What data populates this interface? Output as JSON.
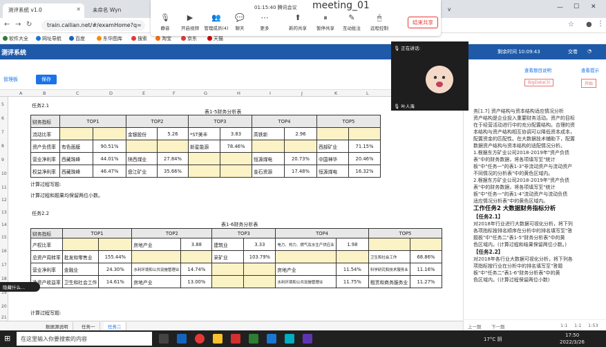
{
  "browser": {
    "tabs": [
      {
        "label": "测评系统 v1.0"
      },
      {
        "label": "未命名 Wyn"
      },
      {
        "label": "v"
      }
    ],
    "url": "train.cailian.net/#/examHome?q=",
    "bookmarks": [
      "软件大全",
      "网址导航",
      "百度",
      "东华图库",
      "搜索",
      "淘宝",
      "京东",
      "天猫"
    ]
  },
  "meeting": {
    "name": "meeting_01",
    "timer": "01:15:40",
    "app": "腾讯会议",
    "buttons": [
      "静音",
      "开启视频",
      "管理成员(4)",
      "聊天",
      "更多",
      "新的共享",
      "暂停共享",
      "互动批注",
      "远程控制"
    ],
    "end_share": "结束共享",
    "speaking": "正在讲话:",
    "participant": "叶人海"
  },
  "app": {
    "title": "测评系统",
    "header_time": "剩余时间 1:00:59:43",
    "header_submit": "交卷"
  },
  "toolbar": {
    "link": "管理板",
    "save": "保存"
  },
  "columns": [
    "A",
    "B",
    "C",
    "D",
    "E",
    "F",
    "G",
    "H",
    "I",
    "J",
    "K",
    "L"
  ],
  "rows": [
    "5",
    "6",
    "7",
    "8",
    "9",
    "10",
    "11",
    "12",
    "13",
    "14",
    "15",
    "16",
    "17",
    "18",
    "19",
    "20",
    "21",
    "22"
  ],
  "task21": {
    "title": "任务2.1",
    "caption": "表1-5财务分析表",
    "headers": [
      "财务指标",
      "TOP1",
      "TOP2",
      "TOP3",
      "TOP4",
      "TOP5"
    ],
    "rows": [
      [
        "流动比率",
        "",
        "",
        "金银股份",
        "5.26",
        "*ST美丰",
        "3.83",
        "高铁新",
        "2.96",
        "",
        ""
      ],
      [
        "资产负债率",
        "有色面膜",
        "90.51%",
        "",
        "",
        "新星能源",
        "78.46%",
        "",
        "",
        "西部矿业",
        "71.15%"
      ],
      [
        "营业净利率",
        "西藏珠峰",
        "44.01%",
        "陕西煤业",
        "27.84%",
        "",
        "",
        "恒源煤电",
        "20.73%",
        "中国神华",
        "20.46%"
      ],
      [
        "权益净利率",
        "西藏珠峰",
        "46.47%",
        "盘江矿业",
        "35.66%",
        "",
        "",
        "金石资源",
        "17.48%",
        "恒源煤电",
        "16.32%"
      ]
    ],
    "note1": "计算过程写题:",
    "note2": "计算过程和题果均保留两位小数。"
  },
  "task22": {
    "title": "任务2.2",
    "caption": "表1-6财务分析表",
    "headers": [
      "财务指标",
      "TOP1",
      "TOP2",
      "TOP3",
      "TOP4",
      "TOP5"
    ],
    "rows": [
      [
        "产权比率",
        "",
        "",
        "房地产业",
        "3.88",
        "建筑业",
        "3.33",
        "电力、热力、燃气及水生产供应业",
        "1.98",
        "",
        ""
      ],
      [
        "总资产周转率",
        "批发和零售业",
        "155.44%",
        "",
        "",
        "采矿业",
        "103.79%",
        "",
        "",
        "卫生和社会工作",
        "68.86%"
      ],
      [
        "营业净利率",
        "金融业",
        "24.30%",
        "水利环境和公共设施管理业",
        "14.74%",
        "",
        "",
        "房地产业",
        "11.54%",
        "科学研究和技术服务业",
        "11.16%"
      ],
      [
        "净资产收益率",
        "卫生和社会工作",
        "14.61%",
        "房地产业",
        "13.00%",
        "",
        "",
        "水利环境和公共设施管理业",
        "11.75%",
        "租赁和商务服务业",
        "11.27%"
      ]
    ],
    "note1": "计算过程写题:"
  },
  "sheet_tabs": [
    "数据源说明",
    "任务一",
    "任务二"
  ],
  "right_panel": {
    "top_label": "剩余时间 10:09:43",
    "links": [
      "查看题目说明",
      "查看提示",
      "BigData(3)",
      "开始"
    ],
    "lines": [
      {
        "kind": "line",
        "text": "务[1.7] 资产结构与资本结构适应情况分析"
      },
      {
        "kind": "line",
        "text": "资产结构是企业投入重要财务活动。资产的目标"
      },
      {
        "kind": "line",
        "text": "在于经营活动进行中的充分配置结构。合理的资"
      },
      {
        "kind": "line",
        "text": "本结构与资产结构相互协调可以降低资本成本，"
      },
      {
        "kind": "line",
        "text": "配置资金的匹配性。在大数据技术辅助下，配置"
      },
      {
        "kind": "line",
        "text": "数据资产结构与资本结构的适配情况分析。"
      },
      {
        "kind": "line",
        "text": "1.根据东方矿业公司2018-2019年\"资产负债"
      },
      {
        "kind": "line",
        "text": "表\"中的财务数据，将各项填写至\"统计"
      },
      {
        "kind": "line",
        "text": "板\"中\"任务一\"的表1-3\"非流动资产与流动资产"
      },
      {
        "kind": "line",
        "text": "不同情况的分析表\"中的黄色区域内。"
      },
      {
        "kind": "line",
        "text": "2.根据东方矿业公司2018-2019年\"资产负债"
      },
      {
        "kind": "line",
        "text": "表\"中的财务数据，将各项填写至\"统计"
      },
      {
        "kind": "line",
        "text": "板\"中\"任务一\"的表1-4\"流动资产与流动负债"
      },
      {
        "kind": "line",
        "text": "适应情况分析表\"中的黄色区域内。"
      },
      {
        "kind": "head",
        "text": "工作任务2 大数据财务指标分析"
      },
      {
        "kind": "sub",
        "text": "【任务2.1】"
      },
      {
        "kind": "line",
        "text": "对2018年行业进行大数据可视化分析，将下列"
      },
      {
        "kind": "line",
        "text": "各项指标按排名顺序在分析中的排名填写至\"答"
      },
      {
        "kind": "line",
        "text": "题板\"中\"任务二\"表1-5\"财务分析表\"中的黄"
      },
      {
        "kind": "line",
        "text": "色区域内。(计算过程和结果保留两位小数。)"
      },
      {
        "kind": "sub",
        "text": "【任务2.2】"
      },
      {
        "kind": "line",
        "text": "对2018年各行业大数据可视化分析，将下列各"
      },
      {
        "kind": "line",
        "text": "项指标按行业在分析中的排名填写至\"答题"
      },
      {
        "kind": "line",
        "text": "板\"中\"任务二\"表1-6\"财务分析表\"中的黄"
      },
      {
        "kind": "line",
        "text": "色区域内。(计算过程保留两位小数)"
      }
    ],
    "footer": [
      "上一题",
      "下一题",
      "1:1",
      "1:1",
      "1:53"
    ]
  },
  "taskbar": {
    "search": "在这里输入你要搜索的内容",
    "weather": "17°C 阴",
    "time": "17:50",
    "date": "2022/3/26",
    "hidden_bar": "隐藏什么..."
  },
  "colors": {
    "header_blue": "#1e5aa8",
    "highlight": "#fbf3c6",
    "accent": "#1a73e8",
    "end_share": "#e53935"
  }
}
